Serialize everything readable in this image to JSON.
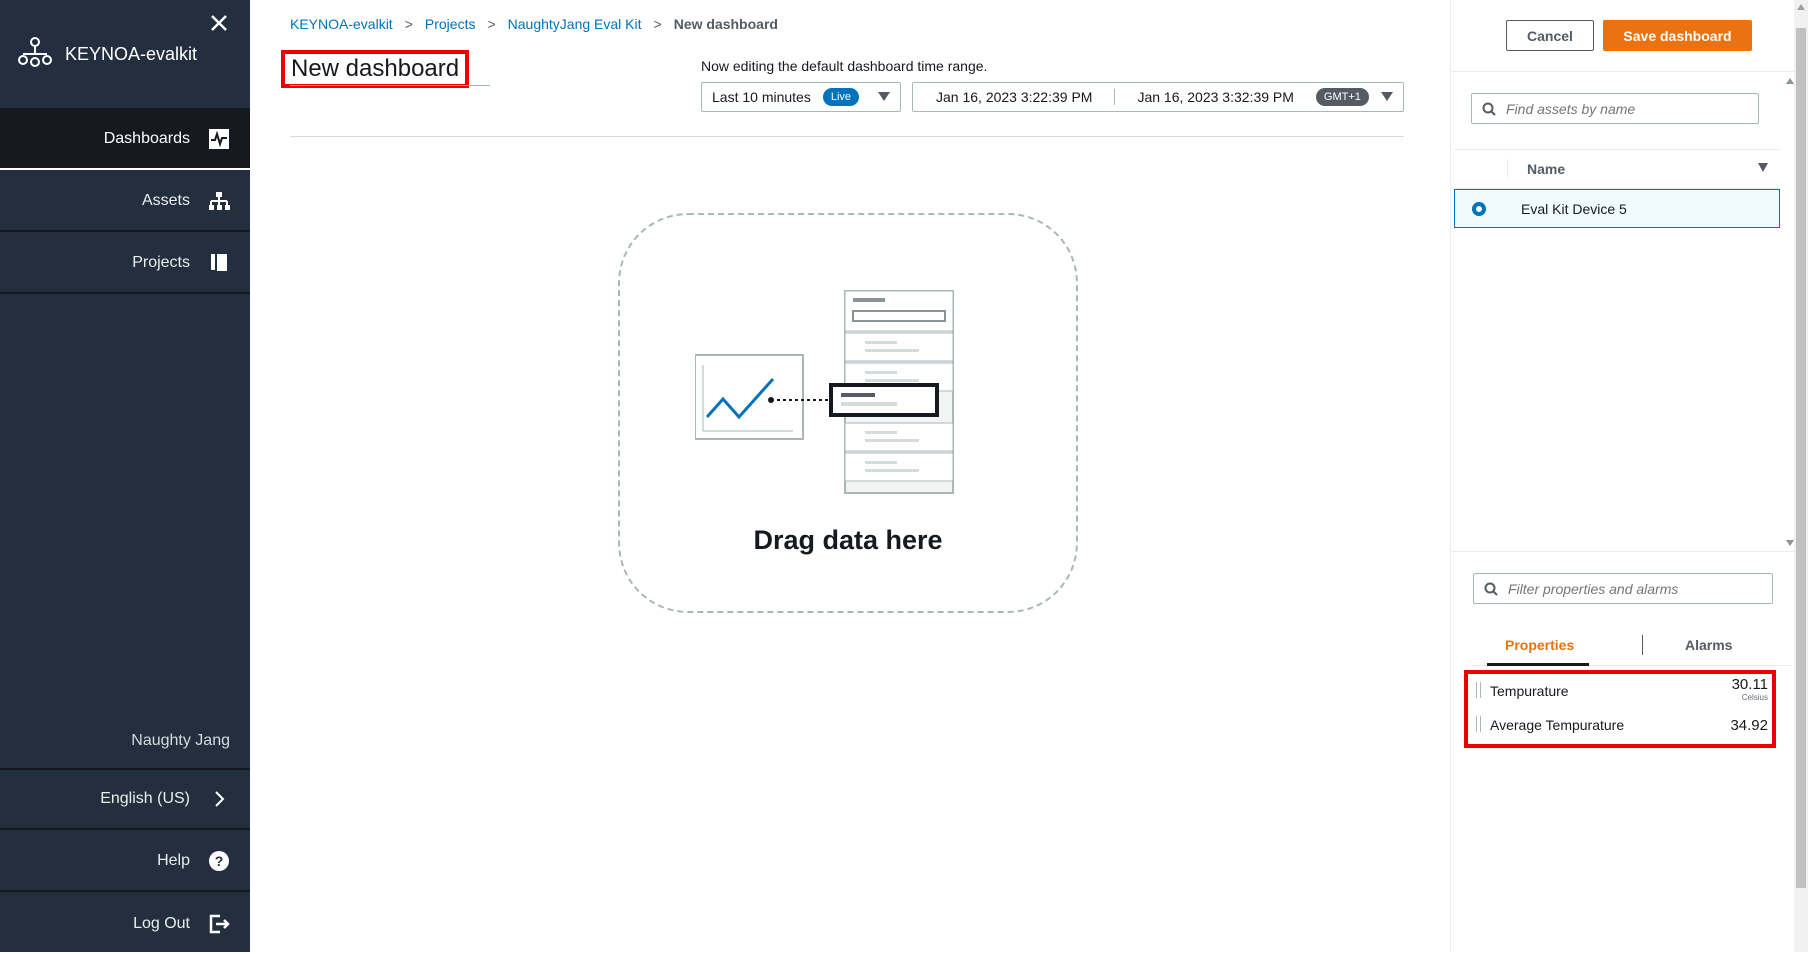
{
  "sidebar": {
    "app_title": "KEYNOA-evalkit",
    "items": [
      {
        "label": "Dashboards",
        "icon": "pulse-icon"
      },
      {
        "label": "Assets",
        "icon": "hierarchy-icon"
      },
      {
        "label": "Projects",
        "icon": "project-icon"
      }
    ],
    "user_name": "Naughty Jang",
    "language": "English (US)",
    "help": "Help",
    "logout": "Log Out"
  },
  "breadcrumb": {
    "items": [
      "KEYNOA-evalkit",
      "Projects",
      "NaughtyJang Eval Kit"
    ],
    "current": "New dashboard"
  },
  "main": {
    "title": "New dashboard",
    "edit_note": "Now editing the default dashboard time range.",
    "range_label": "Last 10 minutes",
    "live_badge": "Live",
    "start_time": "Jan 16, 2023 3:22:39 PM",
    "end_time": "Jan 16, 2023 3:32:39 PM",
    "timezone": "GMT+1",
    "drop_label": "Drag data here"
  },
  "panel": {
    "cancel_label": "Cancel",
    "save_label": "Save dashboard",
    "asset_search_placeholder": "Find assets by name",
    "name_header": "Name",
    "selected_asset": "Eval Kit Device 5",
    "property_search_placeholder": "Filter properties and alarms",
    "tabs": [
      "Properties",
      "Alarms"
    ],
    "properties": [
      {
        "name": "Tempurature",
        "value": "30.11",
        "unit": "Celsius"
      },
      {
        "name": "Average Tempurature",
        "value": "34.92",
        "unit": ""
      }
    ]
  },
  "colors": {
    "sidebar_bg": "#232f3e",
    "accent": "#ec7211",
    "link": "#0073bb",
    "highlight": "#e00000"
  }
}
